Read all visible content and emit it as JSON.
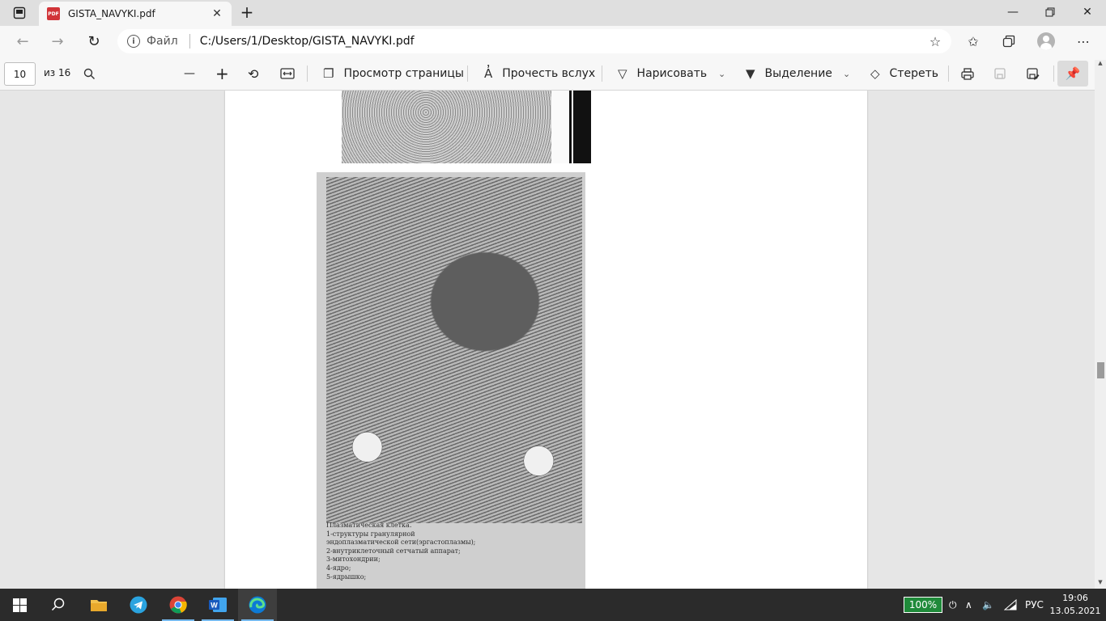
{
  "tab": {
    "title": "GISTA_NAVYKI.pdf",
    "badge": "PDF"
  },
  "address": {
    "scheme": "Файл",
    "url": "C:/Users/1/Desktop/GISTA_NAVYKI.pdf"
  },
  "pdf_toolbar": {
    "current_page": "10",
    "page_total_label": "из 16",
    "page_view_label": "Просмотр страницы",
    "read_aloud_label": "Прочесть вслух",
    "draw_label": "Нарисовать",
    "highlight_label": "Выделение",
    "erase_label": "Стереть"
  },
  "document": {
    "caption_lines": [
      "Плазматическая клетка.",
      "1-структуры гранулярной",
      "эндоплазматической сети(эргастоплазмы);",
      "2-внутриклеточный сетчатый аппарат;",
      "3-митохондрии;",
      "4-ядро;",
      "5-ядрышко;"
    ]
  },
  "taskbar": {
    "battery_label": "100%",
    "language": "РУС",
    "time": "19:06",
    "date": "13.05.2021"
  },
  "colors": {
    "battery": "#1f8a3a",
    "pdf_badge": "#d13438",
    "taskbar": "#2b2b2b"
  }
}
